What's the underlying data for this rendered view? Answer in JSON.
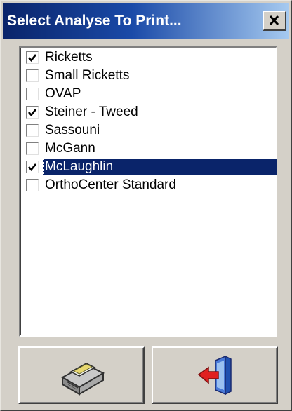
{
  "window": {
    "title": "Select Analyse To Print...",
    "close_glyph": "✕",
    "close_icon": "close-icon"
  },
  "analyses": [
    {
      "label": "Ricketts",
      "checked": true,
      "selected": false
    },
    {
      "label": "Small Ricketts",
      "checked": false,
      "selected": false
    },
    {
      "label": "OVAP",
      "checked": false,
      "selected": false
    },
    {
      "label": "Steiner - Tweed",
      "checked": true,
      "selected": false
    },
    {
      "label": "Sassouni",
      "checked": false,
      "selected": false
    },
    {
      "label": "McGann",
      "checked": false,
      "selected": false
    },
    {
      "label": "McLaughlin",
      "checked": true,
      "selected": true
    },
    {
      "label": "OrthoCenter Standard",
      "checked": false,
      "selected": false
    }
  ],
  "buttons": {
    "print_icon": "printer-icon",
    "exit_icon": "exit-door-icon"
  },
  "colors": {
    "titlebar_start": "#0a246a",
    "titlebar_end": "#a6caf0",
    "selection": "#0a246a",
    "face": "#d4d0c8"
  }
}
